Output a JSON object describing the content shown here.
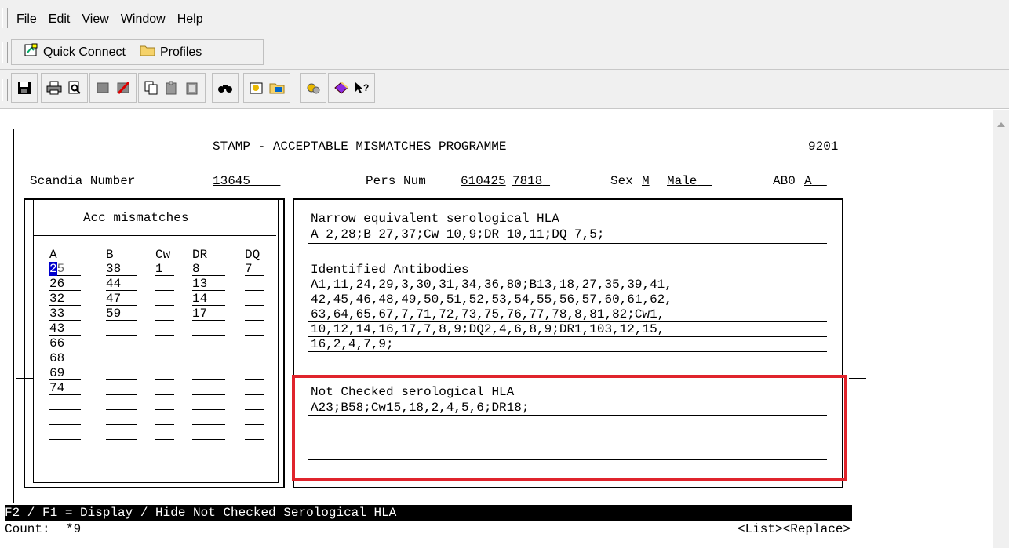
{
  "menu": {
    "items": [
      {
        "label": "File",
        "mnemonic": "F",
        "rest": "ile"
      },
      {
        "label": "Edit",
        "mnemonic": "E",
        "rest": "dit"
      },
      {
        "label": "View",
        "mnemonic": "V",
        "rest": "iew"
      },
      {
        "label": "Window",
        "mnemonic": "W",
        "rest": "indow"
      },
      {
        "label": "Help",
        "mnemonic": "H",
        "rest": "elp"
      }
    ]
  },
  "connbar": {
    "quick_connect": "Quick Connect",
    "profiles": "Profiles"
  },
  "toolbar_icons": [
    "save-icon",
    "print-icon",
    "print-preview-icon",
    "disconnect-icon",
    "disconnect-all-icon",
    "copy-icon",
    "paste-icon",
    "clipboard-icon",
    "find-icon",
    "settings-icon",
    "profile-icon",
    "tools-icon",
    "help-book-icon",
    "context-help-icon"
  ],
  "screen": {
    "title": "STAMP - ACCEPTABLE MISMATCHES PROGRAMME",
    "screen_id": "9201",
    "scandia_label": "Scandia Number",
    "scandia_value": "13645",
    "pers_label": "Pers Num",
    "pers_value1": "610425",
    "pers_value2": "7818",
    "sex_label": "Sex",
    "sex_code": "M",
    "sex_text": "Male",
    "abo_label": "AB0",
    "abo_value": "A"
  },
  "acc": {
    "title": "Acc mismatches",
    "headers": [
      "A",
      "B",
      "Cw",
      "DR",
      "DQ"
    ],
    "rows": [
      [
        "25",
        "38",
        "1",
        "8",
        "7"
      ],
      [
        "26",
        "44",
        "",
        "13",
        ""
      ],
      [
        "32",
        "47",
        "",
        "14",
        ""
      ],
      [
        "33",
        "59",
        "",
        "17",
        ""
      ],
      [
        "43",
        "",
        "",
        "",
        ""
      ],
      [
        "66",
        "",
        "",
        "",
        ""
      ],
      [
        "68",
        "",
        "",
        "",
        ""
      ],
      [
        "69",
        "",
        "",
        "",
        ""
      ],
      [
        "74",
        "",
        "",
        "",
        ""
      ],
      [
        "",
        "",
        "",
        "",
        ""
      ],
      [
        "",
        "",
        "",
        "",
        ""
      ],
      [
        "",
        "",
        "",
        "",
        ""
      ]
    ]
  },
  "narrow": {
    "title": "Narrow equivalent serological HLA",
    "value": "A 2,28;B 27,37;Cw 10,9;DR 10,11;DQ 7,5;"
  },
  "antibodies": {
    "title": "Identified Antibodies",
    "lines": [
      "A1,11,24,29,3,30,31,34,36,80;B13,18,27,35,39,41,",
      "42,45,46,48,49,50,51,52,53,54,55,56,57,60,61,62,",
      "63,64,65,67,7,71,72,73,75,76,77,78,8,81,82;Cw1,",
      "10,12,14,16,17,7,8,9;DQ2,4,6,8,9;DR1,103,12,15,",
      "16,2,4,7,9;"
    ]
  },
  "not_checked": {
    "title": "Not Checked serological HLA",
    "lines": [
      "A23;B58;Cw15,18,2,4,5,6;DR18;",
      "",
      "",
      ""
    ]
  },
  "status": {
    "hint": "F2 / F1 = Display / Hide Not Checked Serological HLA",
    "count_label": "Count:",
    "count_value": "*9",
    "actions": "<List><Replace>"
  },
  "colors": {
    "highlight": "#e0242c",
    "cursor": "#0000cc"
  }
}
